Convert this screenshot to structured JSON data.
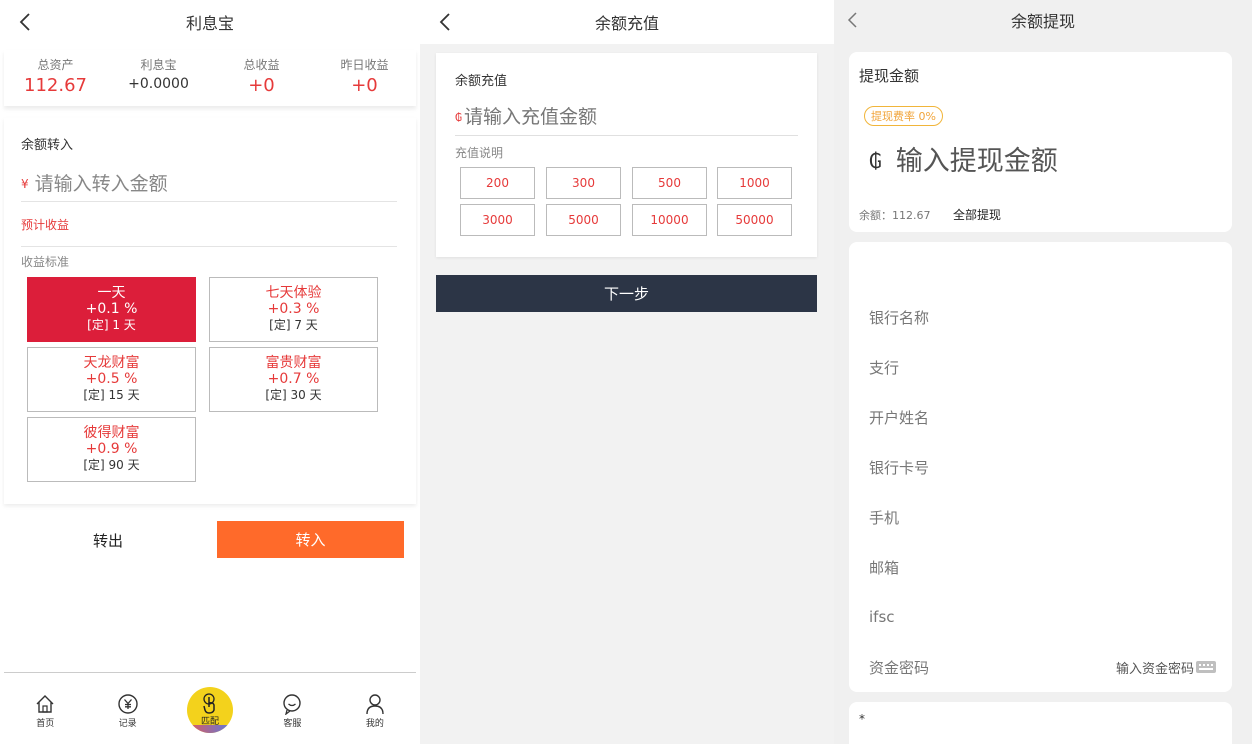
{
  "screen1": {
    "title": "利息宝",
    "stats": [
      {
        "label": "总资产",
        "value": "112.67"
      },
      {
        "label": "利息宝",
        "value": "+0.0000"
      },
      {
        "label": "总收益",
        "value": "+0"
      },
      {
        "label": "昨日收益",
        "value": "+0"
      }
    ],
    "transfer_title": "余额转入",
    "currency_symbol": "¥",
    "amount_placeholder": "请输入转入金额",
    "expected_income": "预计收益",
    "yield_standard": "收益标准",
    "plans": [
      {
        "name": "一天",
        "rate": "+0.1 %",
        "term": "[定] 1 天",
        "active": true
      },
      {
        "name": "七天体验",
        "rate": "+0.3 %",
        "term": "[定] 7 天",
        "active": false
      },
      {
        "name": "天龙财富",
        "rate": "+0.5 %",
        "term": "[定] 15 天",
        "active": false
      },
      {
        "name": "富贵财富",
        "rate": "+0.7 %",
        "term": "[定] 30 天",
        "active": false
      },
      {
        "name": "彼得财富",
        "rate": "+0.9 %",
        "term": "[定] 90 天",
        "active": false
      }
    ],
    "transfer_out": "转出",
    "transfer_in": "转入",
    "tabs": [
      {
        "label": "首页",
        "icon": "home-icon"
      },
      {
        "label": "记录",
        "icon": "yen-circle-icon"
      },
      {
        "label": "匹配",
        "icon": "tap-hand-icon"
      },
      {
        "label": "客服",
        "icon": "chat-icon"
      },
      {
        "label": "我的",
        "icon": "user-icon"
      }
    ]
  },
  "screen2": {
    "title": "余额充值",
    "card_title": "余额充值",
    "currency_symbol": "₲",
    "amount_placeholder": "请输入充值金额",
    "note": "充值说明",
    "amounts": [
      "200",
      "300",
      "500",
      "1000",
      "3000",
      "5000",
      "10000",
      "50000"
    ],
    "next": "下一步"
  },
  "screen3": {
    "title": "余额提现",
    "card_title": "提现金额",
    "fee_badge": "提现费率 0%",
    "currency_symbol": "₲",
    "amount_placeholder": "输入提现金额",
    "balance": "余额：112.67",
    "withdraw_all": "全部提现",
    "fields": [
      "银行名称",
      "支行",
      "开户姓名",
      "银行卡号",
      "手机",
      "邮箱",
      "ifsc",
      "资金密码"
    ],
    "password_placeholder": "输入资金密码",
    "footnote_mark": "*"
  },
  "colors": {
    "accent_red": "#dc1e3a",
    "orange": "#ff6a2a",
    "dark_button": "#2c3546",
    "badge": "#f1b53a"
  }
}
